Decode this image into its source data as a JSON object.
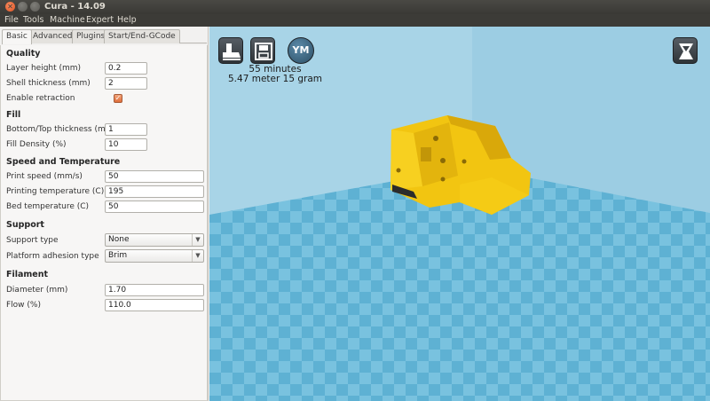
{
  "window": {
    "title": "Cura - 14.09",
    "close_glyph": "✕"
  },
  "menu": [
    "File",
    "Tools",
    "Machine",
    "Expert",
    "Help"
  ],
  "tabs": [
    "Basic",
    "Advanced",
    "Plugins",
    "Start/End-GCode"
  ],
  "quality": {
    "heading": "Quality",
    "layer_height_label": "Layer height (mm)",
    "layer_height": "0.2",
    "shell_thickness_label": "Shell thickness (mm)",
    "shell_thickness": "2",
    "retraction_label": "Enable retraction",
    "retraction_checked": true
  },
  "fill": {
    "heading": "Fill",
    "bottom_top_label": "Bottom/Top thickness (mm)",
    "bottom_top": "1",
    "density_label": "Fill Density (%)",
    "density": "10"
  },
  "speed": {
    "heading": "Speed and Temperature",
    "print_speed_label": "Print speed (mm/s)",
    "print_speed": "50",
    "print_temp_label": "Printing temperature (C)",
    "print_temp": "195",
    "bed_temp_label": "Bed temperature (C)",
    "bed_temp": "50"
  },
  "support": {
    "heading": "Support",
    "type_label": "Support type",
    "type": "None",
    "adhesion_label": "Platform adhesion type",
    "adhesion": "Brim"
  },
  "filament": {
    "heading": "Filament",
    "diameter_label": "Diameter (mm)",
    "diameter": "1.70",
    "flow_label": "Flow (%)",
    "flow": "110.0"
  },
  "viewport": {
    "toolbar_ym": "YM",
    "print_time": "55 minutes",
    "print_material": "5.47 meter 15 gram",
    "icons": [
      "load-icon",
      "save-icon",
      "youmagine-icon",
      "view-mode-icon"
    ]
  },
  "colors": {
    "model": "#f2c511",
    "bed_light": "#7ec5e0",
    "bed_dark": "#5aaed1",
    "wall": "#a7d3e6",
    "accent": "#e05323"
  }
}
